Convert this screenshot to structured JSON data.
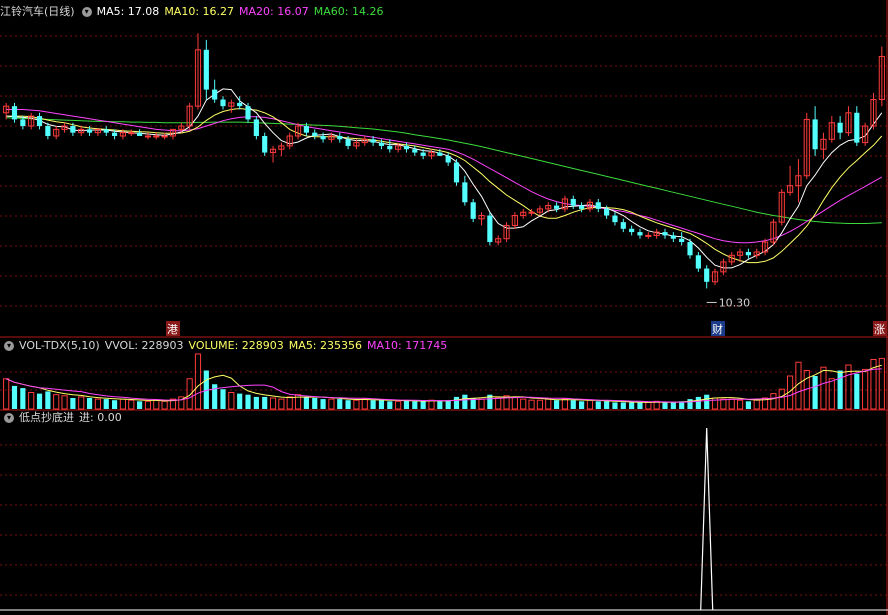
{
  "price_panel": {
    "title": "江铃汽车(日线)",
    "ma5_label": "MA5: 17.08",
    "ma10_label": "MA10: 16.27",
    "ma20_label": "MA20: 16.07",
    "ma60_label": "MA60: 14.26",
    "low_marker": "10.30",
    "tag_left": "港",
    "tag_low": "财",
    "tag_right": "涨"
  },
  "volume_panel": {
    "name": "VOL-TDX(5,10)",
    "vvol_label": "VVOL: 228903",
    "volume_label": "VOLUME: 228903",
    "ma5_label": "MA5: 235356",
    "ma10_label": "MA10: 171745"
  },
  "signal_panel": {
    "name": "低点抄底进",
    "jin_label": "进: 0.00"
  },
  "colors": {
    "up": "#ff3b3b",
    "down": "#54ffff",
    "ma5": "#ffffff",
    "ma10": "#ffff66",
    "ma20": "#ff44ff",
    "ma60": "#3cdc3c",
    "grid": "#7a1010",
    "divider": "#b01818"
  },
  "chart_data": {
    "type": "candlestick",
    "low_value": 10.3,
    "candles": [
      [
        15.6,
        15.9,
        15.4,
        15.8
      ],
      [
        15.8,
        15.9,
        15.3,
        15.4
      ],
      [
        15.4,
        15.5,
        15.1,
        15.2
      ],
      [
        15.2,
        15.6,
        15.1,
        15.5
      ],
      [
        15.5,
        15.6,
        15.1,
        15.2
      ],
      [
        15.2,
        15.3,
        14.8,
        14.9
      ],
      [
        14.9,
        15.2,
        14.8,
        15.1
      ],
      [
        15.1,
        15.3,
        15.0,
        15.2
      ],
      [
        15.2,
        15.3,
        14.9,
        15.0
      ],
      [
        15.0,
        15.2,
        14.9,
        15.1
      ],
      [
        15.1,
        15.2,
        14.9,
        15.0
      ],
      [
        15.0,
        15.1,
        14.9,
        15.1
      ],
      [
        15.1,
        15.2,
        14.9,
        15.0
      ],
      [
        15.0,
        15.1,
        14.8,
        14.9
      ],
      [
        14.9,
        15.1,
        14.8,
        15.0
      ],
      [
        15.0,
        15.1,
        14.9,
        15.0
      ],
      [
        15.0,
        15.1,
        14.9,
        14.9
      ],
      [
        14.9,
        15.0,
        14.8,
        14.9
      ],
      [
        14.9,
        15.0,
        14.8,
        14.9
      ],
      [
        14.9,
        15.0,
        14.8,
        14.9
      ],
      [
        14.9,
        15.1,
        14.8,
        15.1
      ],
      [
        15.1,
        15.3,
        15.0,
        15.2
      ],
      [
        15.2,
        15.9,
        15.1,
        15.8
      ],
      [
        15.8,
        18.0,
        15.7,
        17.5
      ],
      [
        17.5,
        17.8,
        16.0,
        16.3
      ],
      [
        16.3,
        16.6,
        15.9,
        16.0
      ],
      [
        16.0,
        16.1,
        15.7,
        15.8
      ],
      [
        15.8,
        16.0,
        15.6,
        15.9
      ],
      [
        15.9,
        16.1,
        15.7,
        15.8
      ],
      [
        15.8,
        15.9,
        15.3,
        15.4
      ],
      [
        15.4,
        15.5,
        14.8,
        14.9
      ],
      [
        14.9,
        15.0,
        14.3,
        14.4
      ],
      [
        14.4,
        14.6,
        14.1,
        14.5
      ],
      [
        14.5,
        14.7,
        14.3,
        14.6
      ],
      [
        14.6,
        15.0,
        14.5,
        14.9
      ],
      [
        14.9,
        15.3,
        14.8,
        15.2
      ],
      [
        15.2,
        15.3,
        14.9,
        15.0
      ],
      [
        15.0,
        15.1,
        14.8,
        14.9
      ],
      [
        14.9,
        15.0,
        14.7,
        14.8
      ],
      [
        14.8,
        15.0,
        14.7,
        14.9
      ],
      [
        14.9,
        15.0,
        14.7,
        14.8
      ],
      [
        14.8,
        14.9,
        14.5,
        14.6
      ],
      [
        14.6,
        14.8,
        14.5,
        14.7
      ],
      [
        14.7,
        14.9,
        14.6,
        14.8
      ],
      [
        14.8,
        14.9,
        14.6,
        14.7
      ],
      [
        14.7,
        14.8,
        14.5,
        14.6
      ],
      [
        14.6,
        14.8,
        14.4,
        14.5
      ],
      [
        14.5,
        14.7,
        14.4,
        14.6
      ],
      [
        14.6,
        14.7,
        14.4,
        14.5
      ],
      [
        14.5,
        14.6,
        14.3,
        14.4
      ],
      [
        14.4,
        14.5,
        14.2,
        14.3
      ],
      [
        14.3,
        14.5,
        14.2,
        14.4
      ],
      [
        14.4,
        14.5,
        14.3,
        14.3
      ],
      [
        14.3,
        14.4,
        14.0,
        14.1
      ],
      [
        14.1,
        14.2,
        13.4,
        13.5
      ],
      [
        13.5,
        13.7,
        12.8,
        12.9
      ],
      [
        12.9,
        13.0,
        12.3,
        12.4
      ],
      [
        12.4,
        12.6,
        12.2,
        12.5
      ],
      [
        12.5,
        12.6,
        11.6,
        11.7
      ],
      [
        11.7,
        11.9,
        11.6,
        11.8
      ],
      [
        11.8,
        12.3,
        11.7,
        12.2
      ],
      [
        12.2,
        12.6,
        12.1,
        12.5
      ],
      [
        12.5,
        12.7,
        12.4,
        12.6
      ],
      [
        12.6,
        12.7,
        12.5,
        12.6
      ],
      [
        12.6,
        12.8,
        12.5,
        12.7
      ],
      [
        12.7,
        12.9,
        12.6,
        12.8
      ],
      [
        12.8,
        12.9,
        12.6,
        12.7
      ],
      [
        12.7,
        13.1,
        12.6,
        13.0
      ],
      [
        13.0,
        13.1,
        12.7,
        12.8
      ],
      [
        12.8,
        12.9,
        12.6,
        12.7
      ],
      [
        12.7,
        13.0,
        12.6,
        12.9
      ],
      [
        12.9,
        13.0,
        12.6,
        12.7
      ],
      [
        12.7,
        12.8,
        12.4,
        12.5
      ],
      [
        12.5,
        12.6,
        12.2,
        12.3
      ],
      [
        12.3,
        12.4,
        12.0,
        12.1
      ],
      [
        12.1,
        12.2,
        11.9,
        12.0
      ],
      [
        12.0,
        12.1,
        11.8,
        11.9
      ],
      [
        11.9,
        12.0,
        11.8,
        11.9
      ],
      [
        11.9,
        12.1,
        11.8,
        12.0
      ],
      [
        12.0,
        12.1,
        11.8,
        11.9
      ],
      [
        11.9,
        12.0,
        11.7,
        11.8
      ],
      [
        11.8,
        12.0,
        11.6,
        11.7
      ],
      [
        11.7,
        11.8,
        11.2,
        11.3
      ],
      [
        11.3,
        11.4,
        10.8,
        10.9
      ],
      [
        10.9,
        11.0,
        10.3,
        10.5
      ],
      [
        10.5,
        10.9,
        10.4,
        10.8
      ],
      [
        10.8,
        11.2,
        10.7,
        11.1
      ],
      [
        11.1,
        11.4,
        11.0,
        11.3
      ],
      [
        11.3,
        11.5,
        11.1,
        11.4
      ],
      [
        11.4,
        11.5,
        11.2,
        11.3
      ],
      [
        11.3,
        11.5,
        11.2,
        11.4
      ],
      [
        11.4,
        11.8,
        11.3,
        11.7
      ],
      [
        11.7,
        12.4,
        11.6,
        12.3
      ],
      [
        12.3,
        13.3,
        12.2,
        13.2
      ],
      [
        13.2,
        14.0,
        13.1,
        13.4
      ],
      [
        13.4,
        14.2,
        12.9,
        13.7
      ],
      [
        13.7,
        15.6,
        13.6,
        15.4
      ],
      [
        15.4,
        15.8,
        14.3,
        14.5
      ],
      [
        14.5,
        15.0,
        14.2,
        14.8
      ],
      [
        14.8,
        15.5,
        14.7,
        15.3
      ],
      [
        15.3,
        15.5,
        14.8,
        15.0
      ],
      [
        15.0,
        15.8,
        14.9,
        15.6
      ],
      [
        15.6,
        15.8,
        14.6,
        14.7
      ],
      [
        14.7,
        15.3,
        14.6,
        15.2
      ],
      [
        15.2,
        16.2,
        15.1,
        16.0
      ],
      [
        16.0,
        17.6,
        15.8,
        17.3
      ]
    ],
    "volume": [
      55,
      42,
      38,
      30,
      28,
      32,
      26,
      24,
      20,
      22,
      20,
      18,
      18,
      16,
      18,
      16,
      14,
      14,
      16,
      14,
      18,
      22,
      55,
      100,
      70,
      45,
      36,
      30,
      28,
      26,
      22,
      22,
      20,
      18,
      22,
      26,
      22,
      20,
      18,
      18,
      18,
      16,
      16,
      18,
      16,
      16,
      14,
      14,
      16,
      14,
      14,
      16,
      14,
      16,
      22,
      26,
      20,
      18,
      26,
      20,
      24,
      22,
      18,
      16,
      16,
      18,
      16,
      18,
      16,
      14,
      16,
      14,
      14,
      12,
      12,
      12,
      12,
      12,
      14,
      12,
      12,
      14,
      18,
      22,
      26,
      20,
      18,
      18,
      16,
      14,
      16,
      20,
      28,
      36,
      60,
      85,
      70,
      60,
      76,
      55,
      70,
      80,
      64,
      72,
      90,
      92
    ],
    "ma5": [
      15.5,
      15.48,
      15.46,
      15.44,
      15.37,
      15.25,
      15.19,
      15.18,
      15.08,
      15.06,
      15.08,
      15.08,
      15.08,
      15.04,
      15.02,
      15.0,
      14.98,
      14.96,
      14.94,
      14.92,
      14.96,
      15.02,
      15.18,
      15.5,
      15.98,
      16.16,
      16.32,
      16.3,
      15.96,
      15.78,
      15.6,
      15.28,
      15.0,
      14.76,
      14.66,
      14.72,
      14.84,
      14.92,
      14.94,
      14.96,
      14.88,
      14.8,
      14.76,
      14.76,
      14.74,
      14.68,
      14.64,
      14.64,
      14.58,
      14.52,
      14.46,
      14.44,
      14.38,
      14.3,
      14.12,
      13.84,
      13.44,
      13.08,
      12.6,
      12.26,
      12.12,
      12.12,
      12.16,
      12.34,
      12.48,
      12.64,
      12.68,
      12.76,
      12.78,
      12.8,
      12.82,
      12.76,
      12.72,
      12.62,
      12.5,
      12.32,
      12.16,
      12.04,
      11.98,
      11.94,
      11.88,
      11.86,
      11.74,
      11.52,
      11.24,
      11.0,
      10.92,
      10.92,
      11.02,
      11.18,
      11.3,
      11.42,
      11.62,
      11.98,
      12.4,
      12.78,
      13.4,
      13.72,
      14.1,
      14.4,
      14.62,
      14.76,
      14.8,
      14.9,
      15.26,
      15.6
    ],
    "ma10": [
      15.5,
      15.5,
      15.5,
      15.48,
      15.44,
      15.38,
      15.33,
      15.3,
      15.24,
      15.18,
      15.14,
      15.12,
      15.1,
      15.08,
      15.06,
      15.04,
      15.03,
      15.02,
      15.0,
      14.98,
      14.98,
      14.99,
      15.04,
      15.17,
      15.37,
      15.53,
      15.64,
      15.7,
      15.73,
      15.7,
      15.68,
      15.6,
      15.48,
      15.3,
      15.1,
      14.98,
      14.9,
      14.88,
      14.88,
      14.88,
      14.87,
      14.84,
      14.82,
      14.8,
      14.78,
      14.74,
      14.7,
      14.66,
      14.63,
      14.6,
      14.55,
      14.5,
      14.46,
      14.4,
      14.3,
      14.16,
      13.96,
      13.76,
      13.52,
      13.32,
      13.12,
      12.96,
      12.8,
      12.62,
      12.48,
      12.42,
      12.42,
      12.5,
      12.6,
      12.68,
      12.74,
      12.74,
      12.74,
      12.72,
      12.68,
      12.6,
      12.48,
      12.38,
      12.28,
      12.2,
      12.12,
      12.04,
      11.96,
      11.82,
      11.66,
      11.48,
      11.34,
      11.22,
      11.14,
      11.08,
      11.08,
      11.12,
      11.22,
      11.42,
      11.66,
      11.9,
      12.18,
      12.54,
      12.96,
      13.34,
      13.66,
      13.94,
      14.16,
      14.4,
      14.62,
      14.9
    ],
    "ma20": [
      15.7,
      15.7,
      15.7,
      15.68,
      15.66,
      15.62,
      15.58,
      15.54,
      15.5,
      15.46,
      15.42,
      15.38,
      15.34,
      15.3,
      15.26,
      15.22,
      15.18,
      15.14,
      15.1,
      15.08,
      15.06,
      15.06,
      15.08,
      15.12,
      15.2,
      15.28,
      15.36,
      15.42,
      15.46,
      15.48,
      15.48,
      15.46,
      15.42,
      15.36,
      15.3,
      15.24,
      15.18,
      15.14,
      15.1,
      15.06,
      15.02,
      14.98,
      14.94,
      14.9,
      14.86,
      14.82,
      14.78,
      14.74,
      14.7,
      14.66,
      14.62,
      14.58,
      14.54,
      14.5,
      14.42,
      14.32,
      14.2,
      14.06,
      13.92,
      13.78,
      13.64,
      13.5,
      13.36,
      13.22,
      13.1,
      13.0,
      12.92,
      12.86,
      12.82,
      12.8,
      12.78,
      12.74,
      12.7,
      12.66,
      12.62,
      12.56,
      12.5,
      12.44,
      12.36,
      12.28,
      12.2,
      12.12,
      12.04,
      11.96,
      11.88,
      11.8,
      11.74,
      11.7,
      11.68,
      11.68,
      11.7,
      11.74,
      11.8,
      11.9,
      12.02,
      12.16,
      12.32,
      12.48,
      12.64,
      12.8,
      12.96,
      13.1,
      13.24,
      13.38,
      13.52,
      13.66
    ],
    "ma60": [
      15.45,
      15.44,
      15.43,
      15.42,
      15.41,
      15.4,
      15.39,
      15.38,
      15.37,
      15.36,
      15.35,
      15.34,
      15.34,
      15.33,
      15.33,
      15.32,
      15.32,
      15.31,
      15.31,
      15.3,
      15.3,
      15.3,
      15.3,
      15.31,
      15.31,
      15.32,
      15.32,
      15.32,
      15.32,
      15.31,
      15.3,
      15.29,
      15.28,
      15.27,
      15.26,
      15.25,
      15.24,
      15.23,
      15.22,
      15.21,
      15.19,
      15.17,
      15.15,
      15.13,
      15.11,
      15.08,
      15.05,
      15.02,
      14.98,
      14.94,
      14.9,
      14.86,
      14.82,
      14.78,
      14.73,
      14.68,
      14.63,
      14.58,
      14.52,
      14.46,
      14.4,
      14.34,
      14.28,
      14.22,
      14.16,
      14.1,
      14.04,
      13.98,
      13.92,
      13.86,
      13.8,
      13.74,
      13.68,
      13.62,
      13.56,
      13.5,
      13.44,
      13.38,
      13.32,
      13.26,
      13.2,
      13.14,
      13.08,
      13.02,
      12.96,
      12.9,
      12.84,
      12.78,
      12.72,
      12.66,
      12.6,
      12.55,
      12.5,
      12.46,
      12.42,
      12.38,
      12.35,
      12.32,
      12.3,
      12.28,
      12.27,
      12.26,
      12.26,
      12.26,
      12.27,
      12.28
    ],
    "signal": {
      "spike_index": 84,
      "spike_value": 1.0,
      "y_max": 1.0
    }
  }
}
